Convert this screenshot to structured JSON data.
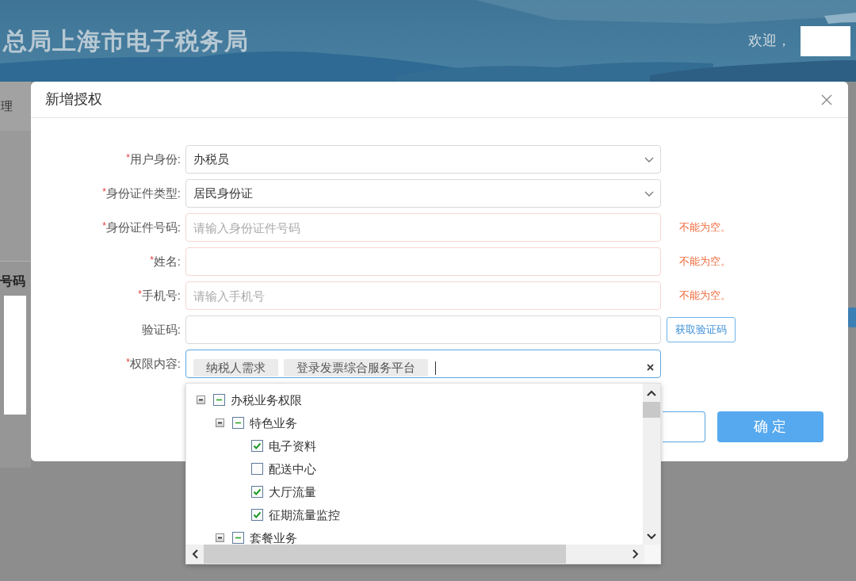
{
  "header": {
    "title": "总局上海市电子税务局",
    "welcome": "欢迎，"
  },
  "page": {
    "menu_item": "理",
    "table_heading": "号码"
  },
  "dialog": {
    "title": "新增授权",
    "fields": [
      {
        "kind": "select",
        "asterisk": "*",
        "label": "用户身份:",
        "value": "办税员"
      },
      {
        "kind": "select",
        "asterisk": "*",
        "label": "身份证件类型:",
        "value": "居民身份证"
      },
      {
        "kind": "input",
        "asterisk": "*",
        "label": "身份证件号码:",
        "placeholder": "请输入身份证件号码",
        "error": "不能为空。"
      },
      {
        "kind": "input",
        "asterisk": "*",
        "label": "姓名:",
        "error": "不能为空。"
      },
      {
        "kind": "input",
        "asterisk": "*",
        "label": "手机号:",
        "placeholder": "请输入手机号",
        "error": "不能为空。"
      },
      {
        "kind": "code",
        "label": "验证码:",
        "button": "获取验证码"
      },
      {
        "kind": "tags",
        "asterisk": "*",
        "label": "权限内容:",
        "tags": [
          "纳税人需求",
          "登录发票综合服务平台"
        ]
      }
    ],
    "tree": [
      {
        "label": "办税业务权限",
        "expanded": true,
        "checked": false,
        "indeterminate": true,
        "children": [
          {
            "label": "特色业务",
            "expanded": true,
            "checked": false,
            "indeterminate": true,
            "children": [
              {
                "label": "电子资料",
                "checked": true
              },
              {
                "label": "配送中心",
                "checked": false
              },
              {
                "label": "大厅流量",
                "checked": true
              },
              {
                "label": "征期流量监控",
                "checked": true
              }
            ]
          },
          {
            "label": "套餐业务",
            "expanded": true,
            "checked": false,
            "indeterminate": true
          }
        ]
      }
    ],
    "buttons": [
      {
        "kind": "cancel"
      },
      {
        "kind": "primary",
        "label": "确 定"
      }
    ]
  }
}
